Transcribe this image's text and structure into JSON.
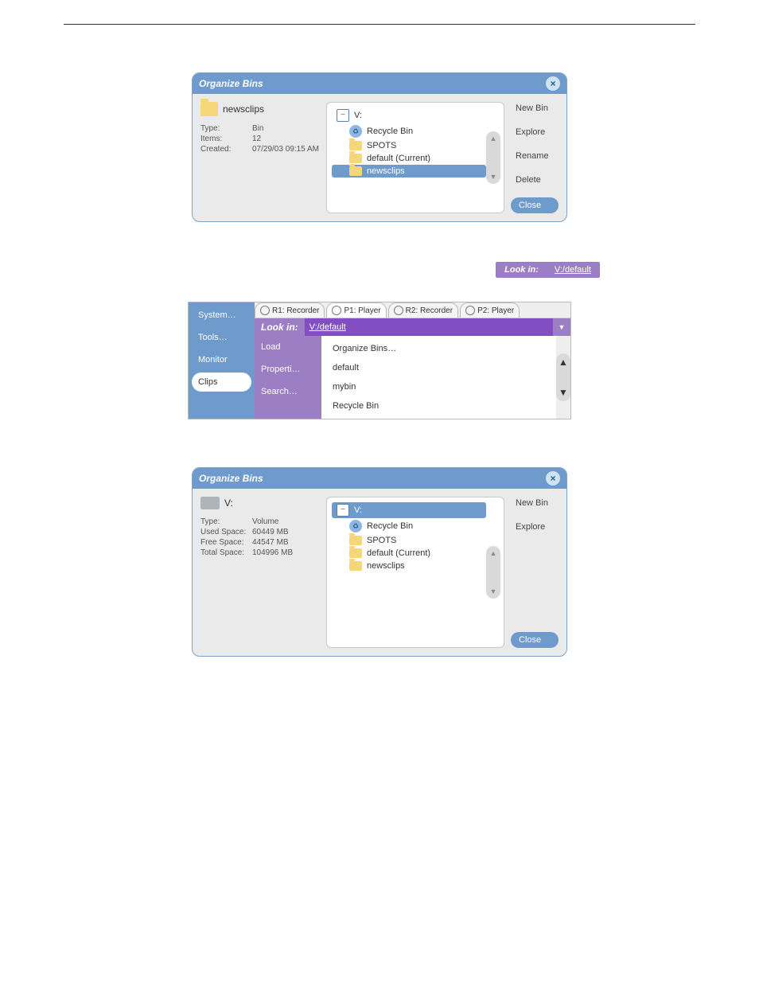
{
  "dialog1": {
    "title": "Organize Bins",
    "selected_name": "newsclips",
    "info": {
      "type_label": "Type:",
      "type_value": "Bin",
      "items_label": "Items:",
      "items_value": "12",
      "created_label": "Created:",
      "created_value": "07/29/03 09:15 AM"
    },
    "root": "V:",
    "tree": {
      "recycle": "Recycle Bin",
      "spots": "SPOTS",
      "default": "default (Current)",
      "newsclips": "newsclips"
    },
    "buttons": {
      "new_bin": "New Bin",
      "explore": "Explore",
      "rename": "Rename",
      "delete": "Delete",
      "close": "Close"
    }
  },
  "lookin_snippet": {
    "label": "Look in:",
    "value": "V:/default"
  },
  "panel2": {
    "sidebar": {
      "system": "System…",
      "tools": "Tools…",
      "monitor": "Monitor",
      "clips": "Clips"
    },
    "purple": {
      "load": "Load",
      "properties": "Properti…",
      "search": "Search…"
    },
    "tabs": {
      "r1": "R1: Recorder",
      "p1": "P1: Player",
      "r2": "R2: Recorder",
      "p2": "P2: Player"
    },
    "lookin_label": "Look in:",
    "path": "V:/default",
    "list": {
      "organize": "Organize Bins…",
      "default": "default",
      "mybin": "mybin",
      "recycle": "Recycle Bin"
    }
  },
  "dialog3": {
    "title": "Organize Bins",
    "selected_name": "V:",
    "info": {
      "type_label": "Type:",
      "type_value": "Volume",
      "used_label": "Used Space:",
      "used_value": "60449 MB",
      "free_label": "Free Space:",
      "free_value": "44547 MB",
      "total_label": "Total Space:",
      "total_value": "104996 MB"
    },
    "root": "V:",
    "tree": {
      "recycle": "Recycle Bin",
      "spots": "SPOTS",
      "default": "default (Current)",
      "newsclips": "newsclips"
    },
    "buttons": {
      "new_bin": "New Bin",
      "explore": "Explore",
      "close": "Close"
    }
  }
}
